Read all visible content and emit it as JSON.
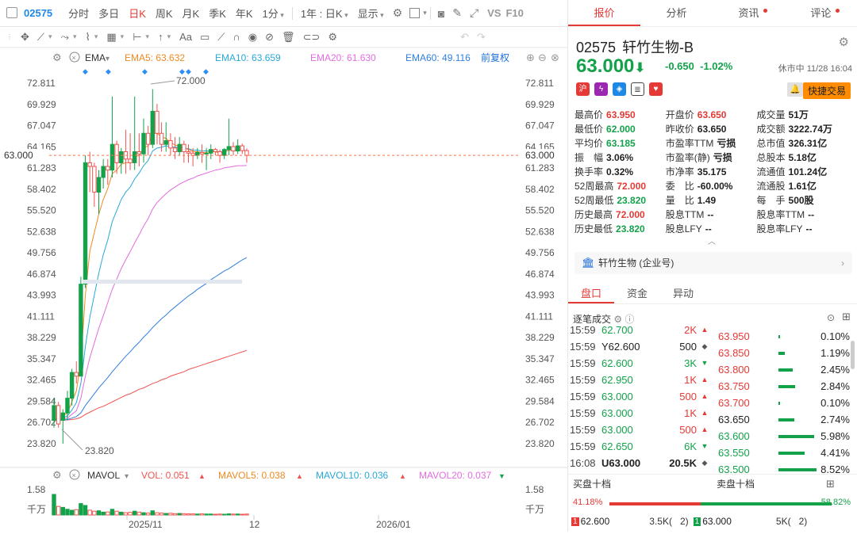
{
  "topbar": {
    "code": "02575",
    "tabs": [
      "分时",
      "多日",
      "日K",
      "周K",
      "月K",
      "季K",
      "年K",
      "1分"
    ],
    "active_tab": "日K",
    "period_select": "1年 : 日K",
    "display_label": "显示",
    "vs_label": "VS",
    "f10_label": "F10"
  },
  "ema_bar": {
    "name": "EMA",
    "ema5_label": "EMA5: 63.632",
    "ema10_label": "EMA10: 63.659",
    "ema20_label": "EMA20: 61.630",
    "ema60_label": "EMA60: 49.116",
    "adjust": "前复权"
  },
  "vol_bar": {
    "name": "MAVOL",
    "vol_label": "VOL: 0.051",
    "mavol5_label": "MAVOL5: 0.038",
    "mavol10_label": "MAVOL10: 0.036",
    "mavol20_label": "MAVOL20: 0.037",
    "vol_axis_top": "1.58",
    "vol_unit": "千万"
  },
  "axis": {
    "y_ticks": [
      "72.811",
      "69.929",
      "67.047",
      "64.165",
      "61.283",
      "58.402",
      "55.520",
      "52.638",
      "49.756",
      "46.874",
      "43.993",
      "41.111",
      "38.229",
      "35.347",
      "32.465",
      "29.584",
      "26.702",
      "23.820"
    ],
    "right_y_ticks": [
      "72.811",
      "69.929",
      "67.047",
      "64.165",
      "63.000",
      "61.283",
      "58.402",
      "55.520",
      "52.638",
      "49.756",
      "46.874",
      "43.993",
      "41.111",
      "38.229",
      "35.347",
      "32.465",
      "29.584",
      "26.702",
      "23.820"
    ],
    "current_price_tag": "63.000",
    "x_labels": [
      "2025/11",
      "12",
      "2026/01"
    ],
    "high_marker": "72.000",
    "low_marker": "23.820"
  },
  "chart_data": {
    "type": "candlestick",
    "ylim": [
      23.82,
      72.811
    ],
    "candles": [
      [
        27.0,
        29.0,
        26.0,
        30.0
      ],
      [
        29.0,
        26.5,
        26.0,
        29.5
      ],
      [
        27.0,
        28.0,
        23.82,
        28.5
      ],
      [
        28.0,
        30.0,
        27.0,
        31.0
      ],
      [
        30.0,
        33.5,
        29.0,
        34.0
      ],
      [
        33.5,
        33.0,
        32.0,
        35.0
      ],
      [
        33.0,
        45.5,
        33.0,
        46.5
      ],
      [
        45.5,
        62.0,
        45.0,
        63.0
      ],
      [
        62.0,
        61.5,
        58.0,
        63.5
      ],
      [
        61.5,
        58.0,
        56.0,
        62.0
      ],
      [
        58.0,
        60.0,
        55.0,
        61.0
      ],
      [
        60.0,
        61.5,
        58.5,
        62.5
      ],
      [
        61.5,
        61.0,
        59.0,
        62.5
      ],
      [
        61.0,
        64.5,
        60.0,
        71.0
      ],
      [
        64.5,
        62.0,
        60.5,
        65.0
      ],
      [
        62.0,
        63.5,
        60.5,
        64.0
      ],
      [
        63.5,
        62.5,
        60.5,
        66.5
      ],
      [
        62.5,
        62.0,
        61.0,
        66.0
      ],
      [
        62.0,
        63.5,
        61.0,
        71.0
      ],
      [
        63.5,
        63.2,
        61.5,
        66.0
      ],
      [
        63.2,
        66.0,
        62.0,
        68.0
      ],
      [
        66.0,
        64.5,
        63.0,
        67.0
      ],
      [
        64.5,
        69.0,
        64.0,
        72.0
      ],
      [
        69.0,
        66.0,
        64.5,
        70.0
      ],
      [
        66.0,
        64.5,
        63.5,
        67.5
      ],
      [
        64.5,
        65.0,
        63.5,
        67.5
      ],
      [
        65.0,
        64.0,
        63.0,
        66.0
      ],
      [
        64.0,
        63.5,
        62.5,
        65.5
      ],
      [
        63.5,
        64.5,
        63.0,
        65.5
      ],
      [
        64.5,
        63.5,
        62.0,
        65.0
      ],
      [
        63.5,
        63.3,
        62.0,
        64.5
      ],
      [
        63.3,
        63.0,
        61.5,
        64.0
      ],
      [
        63.0,
        63.4,
        62.5,
        64.0
      ],
      [
        63.4,
        63.2,
        62.0,
        64.5
      ],
      [
        63.2,
        63.3,
        61.0,
        64.0
      ],
      [
        63.3,
        63.8,
        62.5,
        64.5
      ],
      [
        63.8,
        63.5,
        63.0,
        64.0
      ],
      [
        63.5,
        63.0,
        62.0,
        63.8
      ],
      [
        63.0,
        63.8,
        62.5,
        64.0
      ],
      [
        63.8,
        64.2,
        63.0,
        68.0
      ],
      [
        64.2,
        63.6,
        63.0,
        64.8
      ],
      [
        63.6,
        64.3,
        63.2,
        65.2
      ],
      [
        64.3,
        63.65,
        63.2,
        64.6
      ],
      [
        63.65,
        63.0,
        62.0,
        63.95
      ]
    ],
    "ema5": [
      27,
      27.5,
      27.6,
      28,
      29.5,
      31,
      35,
      44,
      50,
      52.5,
      55,
      57,
      58.5,
      60.5,
      61,
      61.8,
      62,
      62,
      62.8,
      63,
      64,
      64.3,
      66,
      66,
      65.5,
      65.3,
      64.8,
      64.4,
      64.3,
      64,
      63.8,
      63.5,
      63.5,
      63.4,
      63.4,
      63.5,
      63.5,
      63.3,
      63.5,
      63.7,
      63.6,
      63.8,
      63.7,
      63.6
    ],
    "ema10": [
      27,
      27.2,
      27.3,
      27.6,
      28.4,
      29.4,
      32,
      37,
      41,
      44,
      47,
      49.5,
      51.5,
      54,
      55.5,
      57,
      58,
      58.7,
      59.8,
      60.6,
      61.6,
      62.3,
      63.6,
      64,
      64.1,
      64.3,
      64.2,
      64.1,
      64.1,
      64,
      63.9,
      63.7,
      63.7,
      63.6,
      63.6,
      63.6,
      63.6,
      63.5,
      63.6,
      63.7,
      63.7,
      63.8,
      63.7,
      63.66
    ],
    "ema20": [
      27,
      27.1,
      27.1,
      27.3,
      27.8,
      28.3,
      30,
      33,
      35.5,
      37.5,
      39.5,
      41.2,
      43,
      44.8,
      46.2,
      47.6,
      48.8,
      49.9,
      51.1,
      52.2,
      53.4,
      54.4,
      55.7,
      56.6,
      57.2,
      57.8,
      58.3,
      58.7,
      59.1,
      59.4,
      59.7,
      59.9,
      60.2,
      60.4,
      60.6,
      60.8,
      61,
      61.1,
      61.3,
      61.4,
      61.5,
      61.6,
      61.6,
      61.63
    ],
    "ema60": [
      27,
      27.05,
      27.05,
      27.1,
      27.3,
      27.5,
      28,
      29,
      29.8,
      30.6,
      31.4,
      32.1,
      32.8,
      33.6,
      34.3,
      35,
      35.7,
      36.3,
      37,
      37.6,
      38.3,
      38.9,
      39.6,
      40.2,
      40.8,
      41.3,
      41.9,
      42.4,
      42.9,
      43.4,
      43.9,
      44.3,
      44.8,
      45.2,
      45.6,
      46.1,
      46.5,
      46.9,
      47.3,
      47.6,
      48,
      48.4,
      48.8,
      49.116
    ],
    "ema_extra": [
      27,
      27.02,
      27.02,
      27.05,
      27.1,
      27.2,
      27.4,
      27.8,
      28.1,
      28.4,
      28.7,
      28.9,
      29.2,
      29.5,
      29.8,
      30.1,
      30.4,
      30.6,
      30.9,
      31.2,
      31.4,
      31.7,
      32,
      32.2,
      32.5,
      32.7,
      33,
      33.2,
      33.4,
      33.6,
      33.9,
      34.1,
      34.3,
      34.5,
      34.7,
      34.9,
      35.1,
      35.3,
      35.5,
      35.7,
      35.9,
      36.1,
      36.3,
      36.5
    ],
    "volume_max": 1.58,
    "volumes": [
      1.08,
      0.45,
      0.4,
      0.3,
      0.25,
      0.28,
      0.6,
      0.5,
      0.25,
      0.2,
      0.22,
      0.15,
      0.16,
      0.3,
      0.2,
      0.15,
      0.12,
      0.14,
      0.2,
      0.15,
      0.12,
      0.1,
      0.22,
      0.12,
      0.1,
      0.08,
      0.09,
      0.07,
      0.08,
      0.07,
      0.06,
      0.06,
      0.05,
      0.06,
      0.05,
      0.05,
      0.04,
      0.05,
      0.04,
      0.06,
      0.05,
      0.05,
      0.04,
      0.05
    ]
  },
  "quote": {
    "code": "02575",
    "name": "轩竹生物-B",
    "price": "63.000",
    "change": "-0.650",
    "change_pct": "-1.02%",
    "status_time": "休市中 11/28 16:04",
    "quick_trade": "快捷交易",
    "tabs": [
      "报价",
      "分析",
      "资讯",
      "评论"
    ],
    "stats": [
      [
        [
          "最高价",
          "63.950",
          "red"
        ],
        [
          "开盘价",
          "63.650",
          "red"
        ],
        [
          "成交量",
          "51万",
          "dark"
        ]
      ],
      [
        [
          "最低价",
          "62.000",
          "green"
        ],
        [
          "昨收价",
          "63.650",
          "dark"
        ],
        [
          "成交额",
          "3222.74万",
          "dark"
        ]
      ],
      [
        [
          "平均价",
          "63.185",
          "green"
        ],
        [
          "市盈率TTM",
          "亏损",
          "dark"
        ],
        [
          "总市值",
          "326.31亿",
          "dark"
        ]
      ],
      [
        [
          "振　幅",
          "3.06%",
          "dark"
        ],
        [
          "市盈率(静)",
          "亏损",
          "dark"
        ],
        [
          "总股本",
          "5.18亿",
          "dark"
        ]
      ],
      [
        [
          "换手率",
          "0.32%",
          "dark"
        ],
        [
          "市净率",
          "35.175",
          "dark"
        ],
        [
          "流通值",
          "101.24亿",
          "dark"
        ]
      ],
      [
        [
          "52周最高",
          "72.000",
          "red"
        ],
        [
          "委　比",
          "-60.00%",
          "dark"
        ],
        [
          "流通股",
          "1.61亿",
          "dark"
        ]
      ],
      [
        [
          "52周最低",
          "23.820",
          "green"
        ],
        [
          "量　比",
          "1.49",
          "dark"
        ],
        [
          "每　手",
          "500股",
          "dark"
        ]
      ],
      [
        [
          "历史最高",
          "72.000",
          "red"
        ],
        [
          "股息TTM",
          "--",
          "dark"
        ],
        [
          "股息率TTM",
          "--",
          "dark"
        ]
      ],
      [
        [
          "历史最低",
          "23.820",
          "green"
        ],
        [
          "股息LFY",
          "--",
          "dark"
        ],
        [
          "股息率LFY",
          "--",
          "dark"
        ]
      ]
    ],
    "company_link": "轩竹生物 (企业号)"
  },
  "lower": {
    "tabs": [
      "盘口",
      "资金",
      "异动"
    ],
    "tick_title": "逐笔成交",
    "ticks": [
      [
        "15:59",
        "62.700",
        "2K",
        "red"
      ],
      [
        "15:59",
        "Y62.600",
        "500",
        "gray"
      ],
      [
        "15:59",
        "62.600",
        "3K",
        "green"
      ],
      [
        "15:59",
        "62.950",
        "1K",
        "red"
      ],
      [
        "15:59",
        "63.000",
        "500",
        "red"
      ],
      [
        "15:59",
        "63.000",
        "1K",
        "red"
      ],
      [
        "15:59",
        "63.000",
        "500",
        "red"
      ],
      [
        "15:59",
        "62.650",
        "6K",
        "green"
      ],
      [
        "16:08",
        "U63.000",
        "20.5K",
        "gray"
      ]
    ],
    "book": [
      [
        "63.950",
        "0.10%",
        "red",
        0.02
      ],
      [
        "63.850",
        "1.19%",
        "red",
        0.15
      ],
      [
        "63.800",
        "2.45%",
        "red",
        0.35
      ],
      [
        "63.750",
        "2.84%",
        "red",
        0.42
      ],
      [
        "63.700",
        "0.10%",
        "red",
        0.02
      ],
      [
        "63.650",
        "2.74%",
        "dark",
        0.4
      ],
      [
        "63.600",
        "5.98%",
        "green",
        0.9
      ],
      [
        "63.550",
        "4.41%",
        "green",
        0.65
      ],
      [
        "63.500",
        "8.52%",
        "green",
        0.95
      ]
    ],
    "bid10": "买盘十档",
    "ask10": "卖盘十档",
    "bid_pct": "41.18%",
    "ask_pct": "58.82%",
    "bid_ratio": 0.4118,
    "bid1_label": "1",
    "bid1_price": "62.600",
    "bid1_vol": "3.5K(",
    "bid1_count": "2)",
    "ask1_label": "1",
    "ask1_price": "63.000",
    "ask1_vol": "5K(",
    "ask1_count": "2)"
  }
}
